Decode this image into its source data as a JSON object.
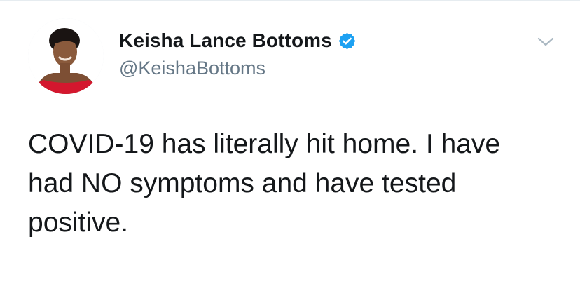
{
  "tweet": {
    "author": {
      "display_name": "Keisha Lance Bottoms",
      "handle": "@KeishaBottoms",
      "verified": true
    },
    "text_lines": [
      "COVID-19 has literally hit home. I have",
      "had NO symptoms and have tested",
      "positive."
    ]
  },
  "icons": {
    "verified": "verified-badge-icon",
    "caret": "chevron-down-icon"
  },
  "colors": {
    "verified_blue": "#1da1f2",
    "name": "#14171a",
    "handle": "#657786",
    "caret": "#aab8c2"
  }
}
